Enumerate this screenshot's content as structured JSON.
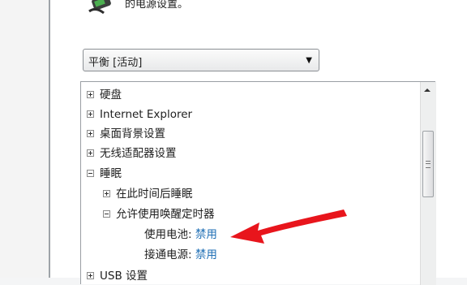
{
  "header": {
    "text": "的电源设置。",
    "icon": "battery-plug-icon"
  },
  "plan_select": {
    "value": "平衡 [活动]"
  },
  "tree": [
    {
      "label": "硬盘",
      "expander": "plus",
      "level": 0
    },
    {
      "label": "Internet Explorer",
      "expander": "plus",
      "level": 0
    },
    {
      "label": "桌面背景设置",
      "expander": "plus",
      "level": 0
    },
    {
      "label": "无线适配器设置",
      "expander": "plus",
      "level": 0
    },
    {
      "label": "睡眠",
      "expander": "minus",
      "level": 0
    },
    {
      "label": "在此时间后睡眠",
      "expander": "plus",
      "level": 1
    },
    {
      "label": "允许使用唤醒定时器",
      "expander": "minus",
      "level": 1
    },
    {
      "label": "使用电池:",
      "value": "禁用",
      "level": 2
    },
    {
      "label": "接通电源:",
      "value": "禁用",
      "level": 2
    },
    {
      "label": "USB 设置",
      "expander": "plus",
      "level": 0
    }
  ],
  "annotation": {
    "arrow_color": "#e8151c"
  }
}
